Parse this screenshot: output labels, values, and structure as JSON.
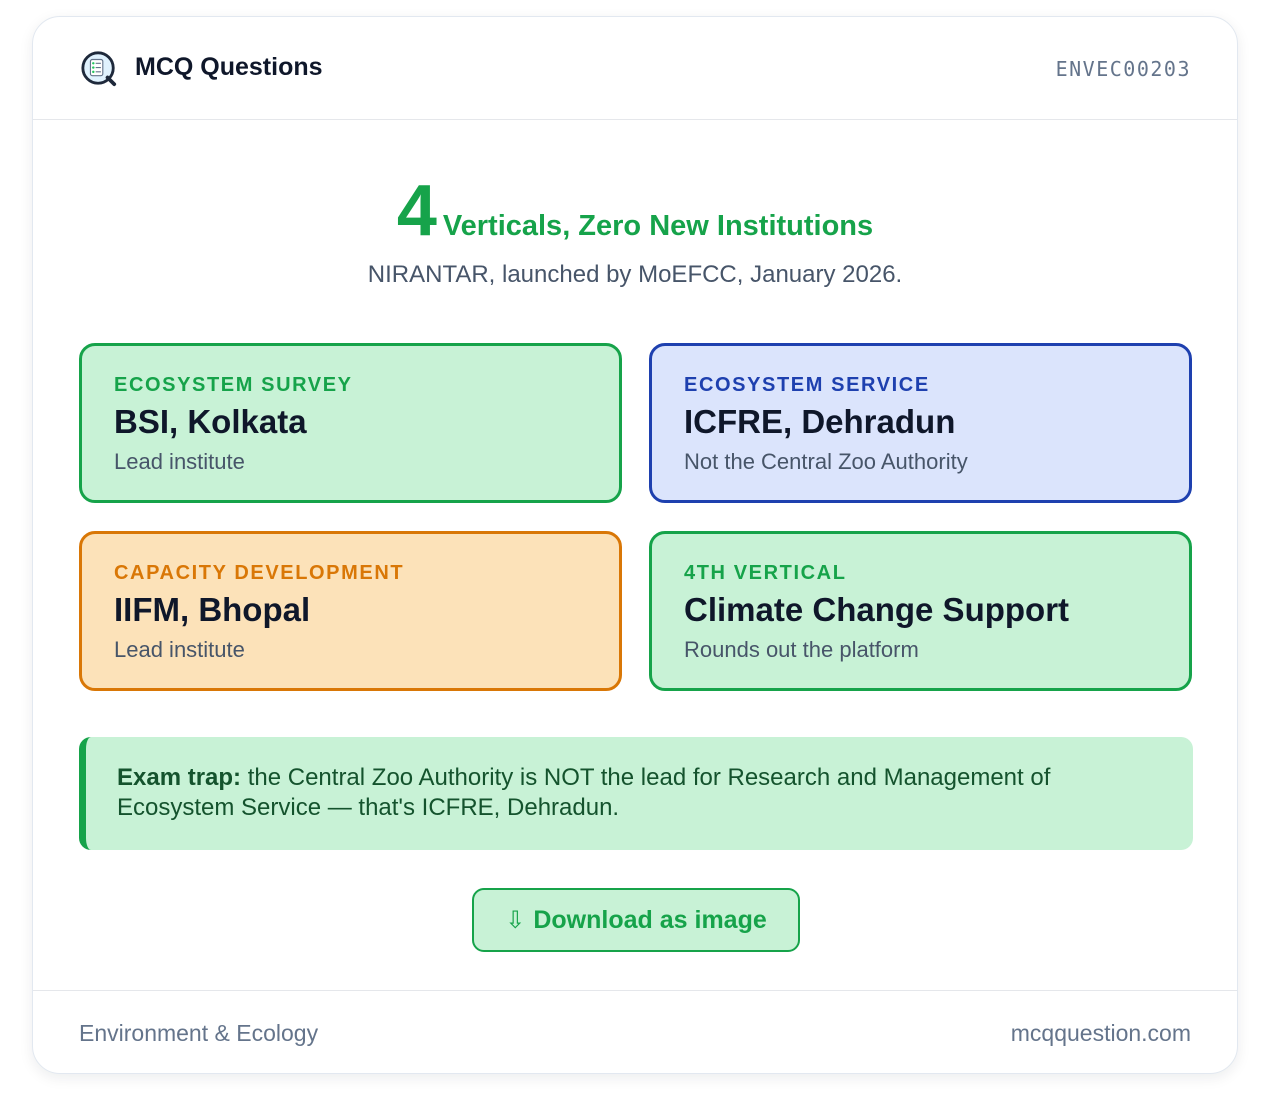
{
  "header": {
    "brand": "MCQ Questions",
    "code": "ENVEC00203"
  },
  "hero": {
    "number": "4",
    "headline": "Verticals, Zero New Institutions",
    "subtitle": "NIRANTAR, launched by MoEFCC, January 2026."
  },
  "tiles": [
    {
      "label": "ECOSYSTEM SURVEY",
      "title": "BSI, Kolkata",
      "subtitle": "Lead institute"
    },
    {
      "label": "ECOSYSTEM SERVICE",
      "title": "ICFRE, Dehradun",
      "subtitle": "Not the Central Zoo Authority"
    },
    {
      "label": "CAPACITY DEVELOPMENT",
      "title": "IIFM, Bhopal",
      "subtitle": "Lead institute"
    },
    {
      "label": "4TH VERTICAL",
      "title": "Climate Change Support",
      "subtitle": "Rounds out the platform"
    }
  ],
  "trap": {
    "lead": "Exam trap:",
    "text": " the Central Zoo Authority is NOT the lead for Research and Management of Ecosystem Service — that's ICFRE, Dehradun."
  },
  "download": {
    "icon": "⇩",
    "label": "Download as image"
  },
  "footer": {
    "category": "Environment & Ecology",
    "site": "mcqquestion.com"
  },
  "colors": {
    "green": "#16a34a",
    "blue": "#1e40af",
    "orange": "#d97706",
    "green_bg": "#c8f2d6",
    "blue_bg": "#dbe4fc",
    "orange_bg": "#fce2b9"
  },
  "icons": {
    "logo": "quiz-logo-icon",
    "download": "download-arrow-icon"
  }
}
